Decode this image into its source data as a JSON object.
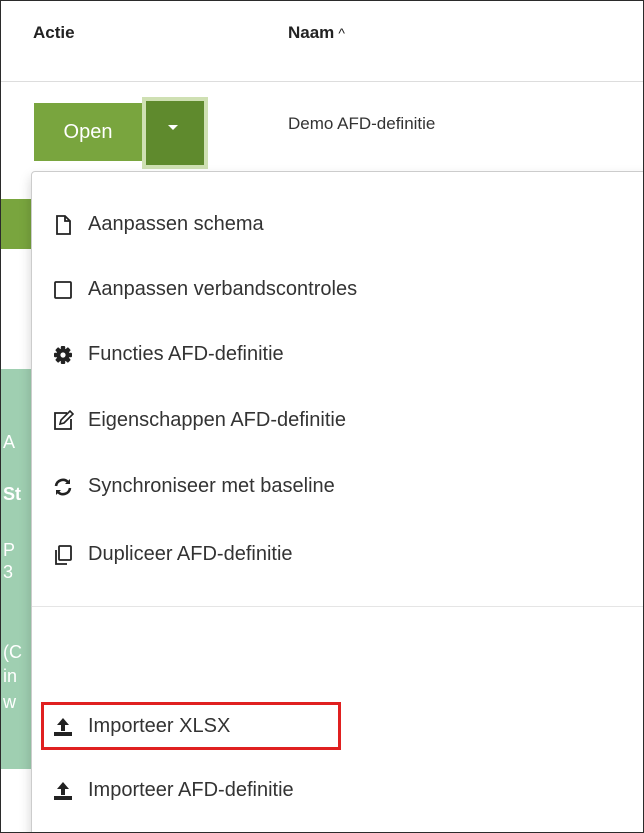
{
  "table": {
    "headers": {
      "actie": "Actie",
      "naam": "Naam",
      "sort_indicator": "^"
    },
    "row": {
      "name": "Demo AFD-definitie",
      "open_label": "Open"
    }
  },
  "strip": {
    "lines": [
      "A",
      "St",
      "P",
      "3",
      "(C",
      "in",
      "w"
    ]
  },
  "menu": {
    "items": [
      {
        "label": "Aanpassen schema",
        "icon": "file-icon"
      },
      {
        "label": "Aanpassen verbandscontroles",
        "icon": "square-icon"
      },
      {
        "label": "Functies AFD-definitie",
        "icon": "gear-icon"
      },
      {
        "label": "Eigenschappen AFD-definitie",
        "icon": "edit-icon"
      },
      {
        "label": "Synchroniseer met baseline",
        "icon": "sync-icon"
      },
      {
        "label": "Dupliceer AFD-definitie",
        "icon": "copy-icon"
      },
      {
        "label": "Importeer XLSX",
        "icon": "upload-icon"
      },
      {
        "label": "Importeer AFD-definitie",
        "icon": "upload-icon"
      }
    ]
  },
  "colors": {
    "primary_green": "#79a53e",
    "dark_green": "#5f8a2d",
    "teal_strip": "#9fcfb1",
    "highlight_red": "#e02020"
  }
}
